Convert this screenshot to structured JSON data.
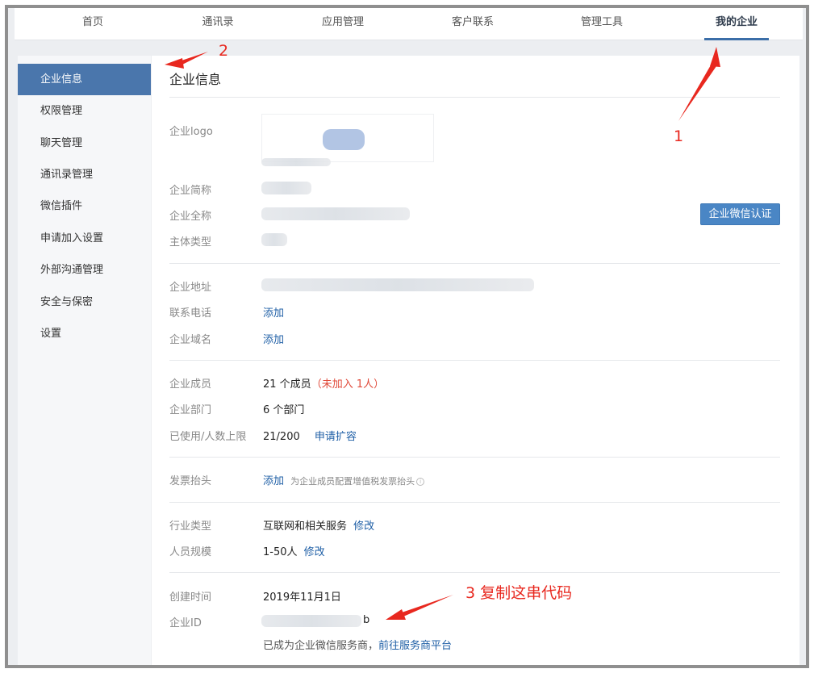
{
  "topnav": {
    "tabs": [
      {
        "label": "首页"
      },
      {
        "label": "通讯录"
      },
      {
        "label": "应用管理"
      },
      {
        "label": "客户联系"
      },
      {
        "label": "管理工具"
      },
      {
        "label": "我的企业"
      }
    ]
  },
  "sidebar": {
    "items": [
      {
        "label": "企业信息"
      },
      {
        "label": "权限管理"
      },
      {
        "label": "聊天管理"
      },
      {
        "label": "通讯录管理"
      },
      {
        "label": "微信插件"
      },
      {
        "label": "申请加入设置"
      },
      {
        "label": "外部沟通管理"
      },
      {
        "label": "安全与保密"
      },
      {
        "label": "设置"
      }
    ]
  },
  "main": {
    "title": "企业信息",
    "logo_label": "企业logo",
    "short_name_label": "企业简称",
    "full_name_label": "企业全称",
    "entity_type_label": "主体类型",
    "cert_button": "企业微信认证",
    "address_label": "企业地址",
    "phone_label": "联系电话",
    "phone_action": "添加",
    "domain_label": "企业域名",
    "domain_action": "添加",
    "members_label": "企业成员",
    "members_value": "21 个成员",
    "members_unjoined": "（未加入 1人）",
    "departments_label": "企业部门",
    "departments_value": "6 个部门",
    "usage_label": "已使用/人数上限",
    "usage_value": "21/200",
    "usage_action": "申请扩容",
    "invoice_label": "发票抬头",
    "invoice_action": "添加",
    "invoice_hint": "为企业成员配置增值税发票抬头",
    "industry_label": "行业类型",
    "industry_value": "互联网和相关服务",
    "industry_action": "修改",
    "scale_label": "人员规模",
    "scale_value": "1-50人",
    "scale_action": "修改",
    "created_label": "创建时间",
    "created_value": "2019年11月1日",
    "corpid_label": "企业ID",
    "corpid_tail": "b",
    "provider_text": "已成为企业微信服务商，",
    "provider_link": "前往服务商平台"
  },
  "annotations": {
    "a1": "1",
    "a2": "2",
    "a3": "3 复制这串代码",
    "color": "#e8281f"
  }
}
